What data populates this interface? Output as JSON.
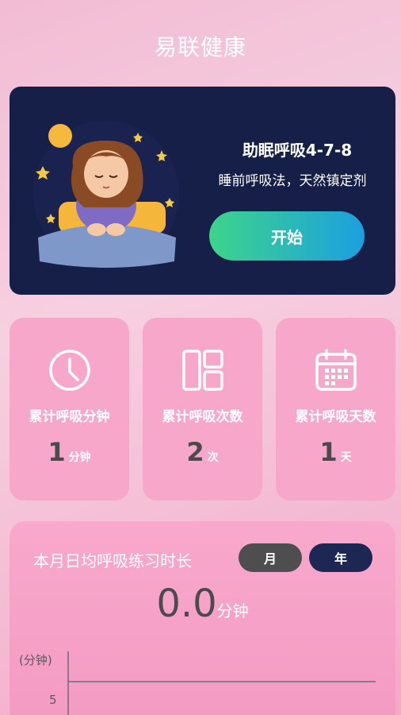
{
  "app": {
    "title": "易联健康"
  },
  "hero": {
    "title": "助眠呼吸4-7-8",
    "subtitle": "睡前呼吸法，天然镇定剂",
    "start_label": "开始"
  },
  "stats": [
    {
      "label": "累计呼吸分钟",
      "value": "1",
      "unit": "分钟",
      "icon": "clock-icon"
    },
    {
      "label": "累计呼吸次数",
      "value": "2",
      "unit": "次",
      "icon": "layout-icon"
    },
    {
      "label": "累计呼吸天数",
      "value": "1",
      "unit": "天",
      "icon": "calendar-icon"
    }
  ],
  "chart_section": {
    "title": "本月日均呼吸练习时长",
    "toggle_month": "月",
    "toggle_year": "年",
    "value": "0.0",
    "value_unit": "分钟"
  },
  "chart_data": {
    "type": "line",
    "ylabel": "(分钟)",
    "y_ticks": [
      "5"
    ],
    "series": []
  }
}
